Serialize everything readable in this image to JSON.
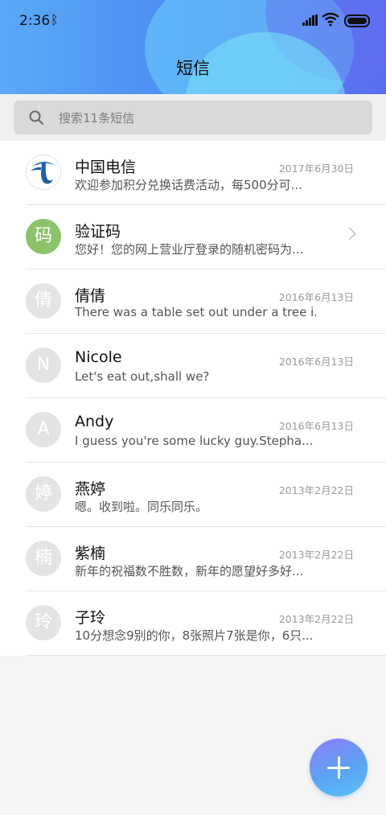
{
  "status_bar": {
    "time": "2:36",
    "bluetooth_icon": "ᛒ"
  },
  "header": {
    "title": "短信"
  },
  "search": {
    "placeholder": "搜索11条短信"
  },
  "messages": [
    {
      "avatar": "",
      "avatar_kind": "telecom-logo",
      "name": "中国电信",
      "date": "2017年6月30日",
      "preview": "欢迎参加积分兑换话费活动，每500分可..."
    },
    {
      "avatar": "码",
      "avatar_kind": "green",
      "name": "验证码",
      "date": "",
      "preview": "您好！您的网上营业厅登录的随机密码为..."
    },
    {
      "avatar": "倩",
      "avatar_kind": "gray",
      "name": "倩倩",
      "date": "2016年6月13日",
      "preview": "There was a table set out under a tree i..."
    },
    {
      "avatar": "N",
      "avatar_kind": "gray",
      "name": "Nicole",
      "date": "2016年6月13日",
      "preview": "Let's eat out,shall we?"
    },
    {
      "avatar": "A",
      "avatar_kind": "gray",
      "name": "Andy",
      "date": "2016年6月13日",
      "preview": "I guess you're some lucky guy.Stepha..."
    },
    {
      "avatar": "婷",
      "avatar_kind": "gray",
      "name": "燕婷",
      "date": "2013年2月22日",
      "preview": "嗯。收到啦。同乐同乐。"
    },
    {
      "avatar": "楠",
      "avatar_kind": "gray",
      "name": "紫楠",
      "date": "2013年2月22日",
      "preview": "新年的祝福数不胜数，新年的愿望好多好..."
    },
    {
      "avatar": "玲",
      "avatar_kind": "gray",
      "name": "子玲",
      "date": "2013年2月22日",
      "preview": "10分想念9别的你，8张照片7张是你，6只..."
    }
  ],
  "colors": {
    "accent": "#4d8ef3",
    "avatar_gray": "#e4e4e4",
    "avatar_green": "#8cc36a",
    "telecom_blue": "#1f5fa8"
  }
}
